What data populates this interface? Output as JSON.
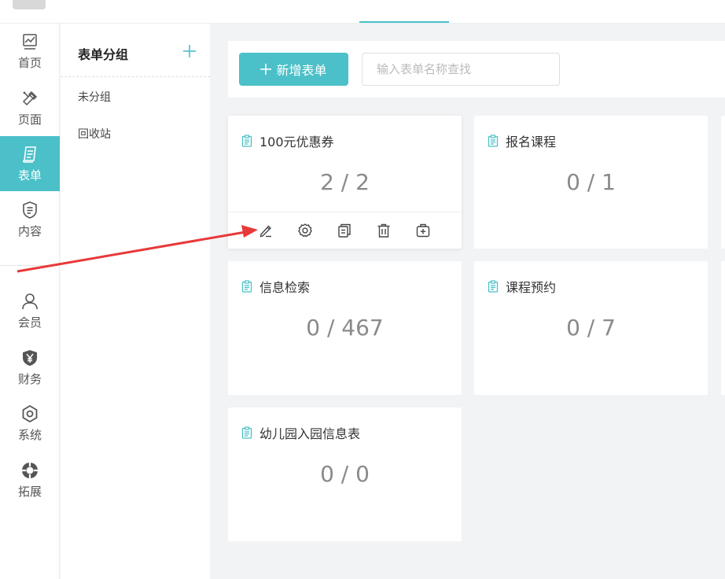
{
  "nav": {
    "items": [
      {
        "label": "首页",
        "icon": "chart-icon"
      },
      {
        "label": "页面",
        "icon": "pencil-ruler-icon"
      },
      {
        "label": "表单",
        "icon": "form-icon"
      },
      {
        "label": "内容",
        "icon": "content-icon"
      },
      {
        "label": "会员",
        "icon": "user-icon"
      },
      {
        "label": "财务",
        "icon": "yen-shield-icon"
      },
      {
        "label": "系统",
        "icon": "gear-hex-icon"
      },
      {
        "label": "拓展",
        "icon": "extension-icon"
      }
    ],
    "active": "表单"
  },
  "groups": {
    "title": "表单分组",
    "items": [
      "未分组",
      "回收站"
    ]
  },
  "toolbar": {
    "new_form_label": "新增表单",
    "search_placeholder": "输入表单名称查找"
  },
  "forms": [
    {
      "name": "100元优惠券",
      "count": "2 / 2"
    },
    {
      "name": "报名课程",
      "count": "0 / 1"
    },
    {
      "name": "信息检索",
      "count": "0 / 467"
    },
    {
      "name": "课程预约",
      "count": "0 / 7"
    },
    {
      "name": "幼儿园入园信息表",
      "count": "0 / 0"
    }
  ],
  "card_actions": [
    "edit-icon",
    "settings-icon",
    "copy-icon",
    "delete-icon",
    "add-icon"
  ],
  "colors": {
    "accent": "#4bc0c8",
    "arrow": "#e8393a"
  }
}
